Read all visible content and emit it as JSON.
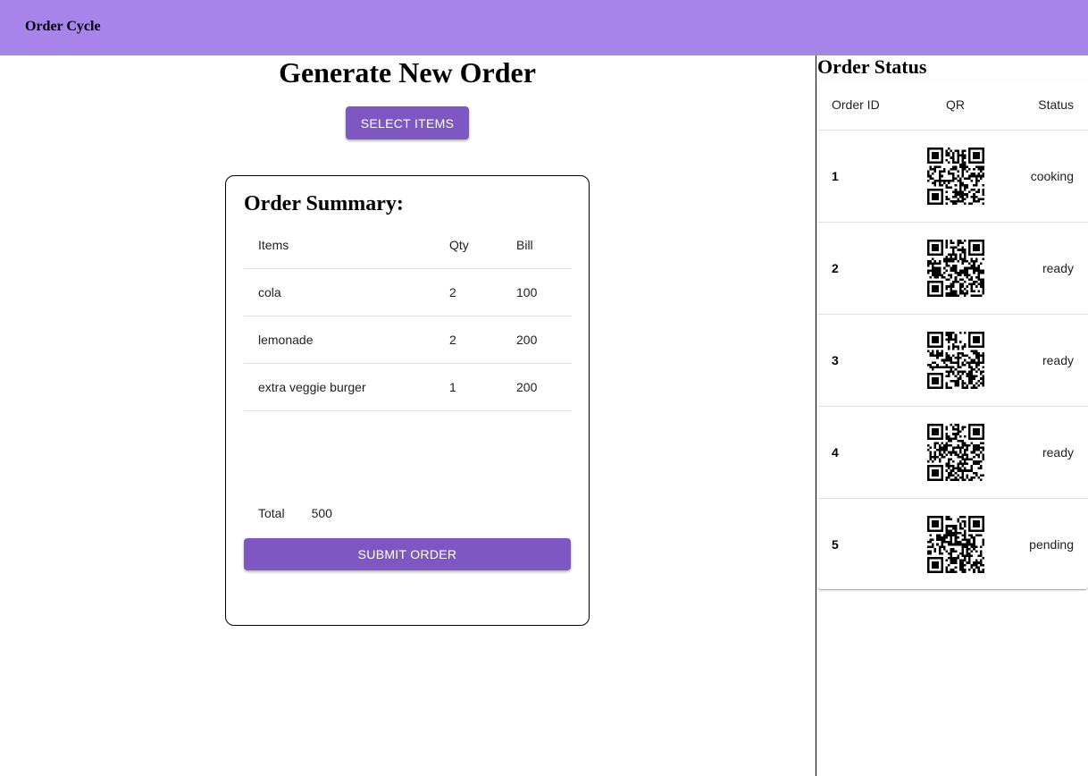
{
  "app": {
    "title": "Order Cycle"
  },
  "colors": {
    "appbar": "#a784ea",
    "primary_button": "#7e57c2"
  },
  "new_order": {
    "heading": "Generate New Order",
    "select_items_label": "SELECT ITEMS"
  },
  "summary": {
    "title": "Order Summary:",
    "columns": {
      "items": "Items",
      "qty": "Qty",
      "bill": "Bill"
    },
    "rows": [
      {
        "item": "cola",
        "qty": "2",
        "bill": "100"
      },
      {
        "item": "lemonade",
        "qty": "2",
        "bill": "200"
      },
      {
        "item": "extra veggie burger",
        "qty": "1",
        "bill": "200"
      }
    ],
    "total_label": "Total",
    "total_value": "500",
    "submit_label": "SUBMIT ORDER"
  },
  "status": {
    "title": "Order Status",
    "columns": {
      "id": "Order ID",
      "qr": "QR",
      "status": "Status"
    },
    "rows": [
      {
        "id": "1",
        "status": "cooking",
        "qr_icon": "qr-code-icon"
      },
      {
        "id": "2",
        "status": "ready",
        "qr_icon": "qr-code-icon"
      },
      {
        "id": "3",
        "status": "ready",
        "qr_icon": "qr-code-icon"
      },
      {
        "id": "4",
        "status": "ready",
        "qr_icon": "qr-code-icon"
      },
      {
        "id": "5",
        "status": "pending",
        "qr_icon": "qr-code-icon"
      }
    ]
  }
}
